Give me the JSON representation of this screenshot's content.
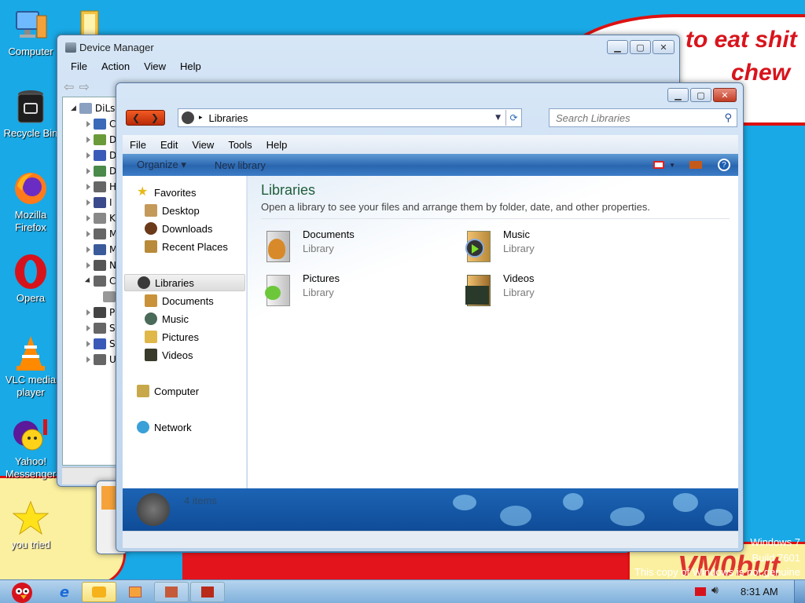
{
  "wallpaper": {
    "bubble_line1": "to eat shit",
    "bubble_line2": "chew",
    "watermark": [
      "Windows 7",
      "Build 7601",
      "This copy of Windows is not genuine"
    ],
    "vmobut": "VM0but"
  },
  "desktop_icons": [
    {
      "label": "Computer",
      "icon": "computer-icon"
    },
    {
      "label": "Recycle Bin",
      "icon": "recycle-bin-icon"
    },
    {
      "label": "Mozilla Firefox",
      "icon": "firefox-icon"
    },
    {
      "label": "Opera",
      "icon": "opera-icon"
    },
    {
      "label": "VLC media player",
      "icon": "vlc-icon"
    },
    {
      "label": "Yahoo! Messenger",
      "icon": "yahoo-messenger-icon"
    },
    {
      "label": "you tried",
      "icon": "star-icon"
    }
  ],
  "device_manager": {
    "title": "Device Manager",
    "menu": [
      "File",
      "Action",
      "View",
      "Help"
    ],
    "root_label": "DiLs",
    "tree_letters": [
      "C",
      "D",
      "D",
      "D",
      "H",
      "I",
      "K",
      "M",
      "M",
      "N",
      "C",
      "",
      "P",
      "S",
      "S",
      "U"
    ]
  },
  "explorer": {
    "address": "Libraries",
    "search_placeholder": "Search Libraries",
    "menu": [
      "File",
      "Edit",
      "View",
      "Tools",
      "Help"
    ],
    "toolbar": {
      "organize": "Organize",
      "new_library": "New library"
    },
    "nav": {
      "favorites": "Favorites",
      "favorites_items": [
        "Desktop",
        "Downloads",
        "Recent Places"
      ],
      "libraries": "Libraries",
      "libraries_items": [
        "Documents",
        "Music",
        "Pictures",
        "Videos"
      ],
      "computer": "Computer",
      "network": "Network"
    },
    "heading": "Libraries",
    "description": "Open a library to see your files and arrange them by folder, date, and other properties.",
    "libraries": [
      {
        "name": "Documents",
        "type": "Library"
      },
      {
        "name": "Music",
        "type": "Library"
      },
      {
        "name": "Pictures",
        "type": "Library"
      },
      {
        "name": "Videos",
        "type": "Library"
      }
    ],
    "status": "4 items"
  },
  "taskbar": {
    "clock": "8:31 AM"
  }
}
